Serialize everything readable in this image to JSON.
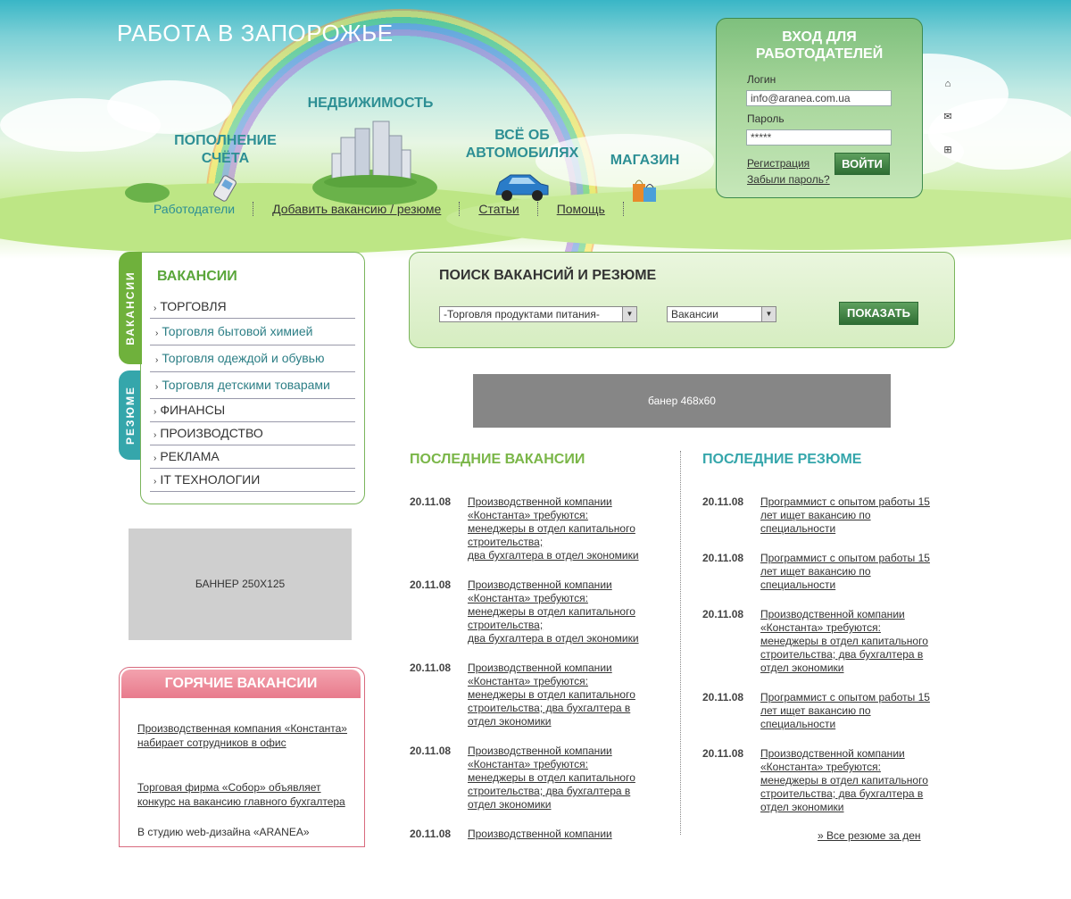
{
  "header": {
    "site_title": "РАБОТА В ЗАПОРОЖЬЕ",
    "categories": [
      {
        "label": "ПОПОЛНЕНИЕ СЧЁТА",
        "icon": "mobile-phone-icon"
      },
      {
        "label": "НЕДВИЖИМОСТЬ",
        "icon": "buildings-icon"
      },
      {
        "label": "ВСЁ ОБ АВТОМОБИЛЯХ",
        "icon": "car-icon"
      },
      {
        "label": "МАГАЗИН",
        "icon": "shopping-bags-icon"
      }
    ],
    "nav": [
      {
        "label": "Работодатели",
        "active": true
      },
      {
        "label": "Добавить вакансию / резюме"
      },
      {
        "label": "Статьи"
      },
      {
        "label": "Помощь"
      }
    ]
  },
  "login": {
    "title": "ВХОД ДЛЯ РАБОТОДАТЕЛЕЙ",
    "login_label": "Логин",
    "login_value": "info@aranea.com.ua",
    "password_label": "Пароль",
    "password_value": "*****",
    "register": "Регистрация",
    "forgot": "Забыли пароль?",
    "button": "ВОЙТИ"
  },
  "side_icons": [
    "home-icon",
    "mail-icon",
    "sitemap-icon"
  ],
  "left": {
    "tab_vacancies": "ВАКАНСИИ",
    "tab_resumes": "РЕЗЮМЕ",
    "heading": "ВАКАНСИИ",
    "items": [
      {
        "label": "ТОРГОВЛЯ",
        "sub": false
      },
      {
        "label": "Торговля бытовой химией",
        "sub": true
      },
      {
        "label": "Торговля одеждой и обувью",
        "sub": true
      },
      {
        "label": "Торговля детскими товарами",
        "sub": true
      },
      {
        "label": "ФИНАНСЫ",
        "sub": false
      },
      {
        "label": "ПРОИЗВОДСТВО",
        "sub": false
      },
      {
        "label": "РЕКЛАМА",
        "sub": false
      },
      {
        "label": "IT ТЕХНОЛОГИИ",
        "sub": false
      }
    ],
    "banner": "БАННЕР 250X125",
    "hot": {
      "heading": "ГОРЯЧИЕ ВАКАНСИИ",
      "items": [
        "Производственная компания «Константа» набирает сотрудников в офис",
        "Торговая фирма «Собор» объявляет конкурс на вакансию главного бухгалтера",
        "В студию web-дизайна «ARANEA»"
      ]
    }
  },
  "search": {
    "title": "ПОИСК ВАКАНСИЙ И РЕЗЮМЕ",
    "category_value": "-Торговля продуктами питания-",
    "type_value": "Вакансии",
    "button": "ПОКАЗАТЬ"
  },
  "banner468": "банер 468x60",
  "vacancies": {
    "heading": "ПОСЛЕДНИЕ ВАКАНСИИ",
    "color": "#7ab648",
    "items": [
      {
        "date": "20.11.08",
        "text": "Производственной компании «Константа» требуются: менеджеры в отдел капитального строительства;\nдва бухгалтера в отдел экономики"
      },
      {
        "date": "20.11.08",
        "text": "Производственной компании «Константа» требуются: менеджеры в отдел капитального строительства;\nдва бухгалтера в отдел экономики"
      },
      {
        "date": "20.11.08",
        "text": "Производственной компании «Константа» требуются: менеджеры в отдел капитального строительства; два бухгалтера в отдел экономики"
      },
      {
        "date": "20.11.08",
        "text": "Производственной компании «Константа» требуются: менеджеры в отдел капитального строительства; два бухгалтера в отдел экономики"
      },
      {
        "date": "20.11.08",
        "text": "Производственной компании"
      }
    ]
  },
  "resumes": {
    "heading": "ПОСЛЕДНИЕ РЕЗЮМЕ",
    "color": "#35a6ab",
    "items": [
      {
        "date": "20.11.08",
        "text": "Программист с опытом работы 15 лет ищет вакансию по специальности"
      },
      {
        "date": "20.11.08",
        "text": "Программист с опытом работы 15 лет ищет вакансию по специальности"
      },
      {
        "date": "20.11.08",
        "text": "Производственной компании «Константа» требуются: менеджеры в отдел капитального строительства; два бухгалтера в отдел экономики"
      },
      {
        "date": "20.11.08",
        "text": "Программист с опытом работы 15 лет ищет вакансию по специальности"
      },
      {
        "date": "20.11.08",
        "text": "Производственной компании «Константа» требуются: менеджеры в отдел капитального строительства; два бухгалтера в отдел экономики"
      }
    ],
    "more": "» Все резюме за ден"
  }
}
